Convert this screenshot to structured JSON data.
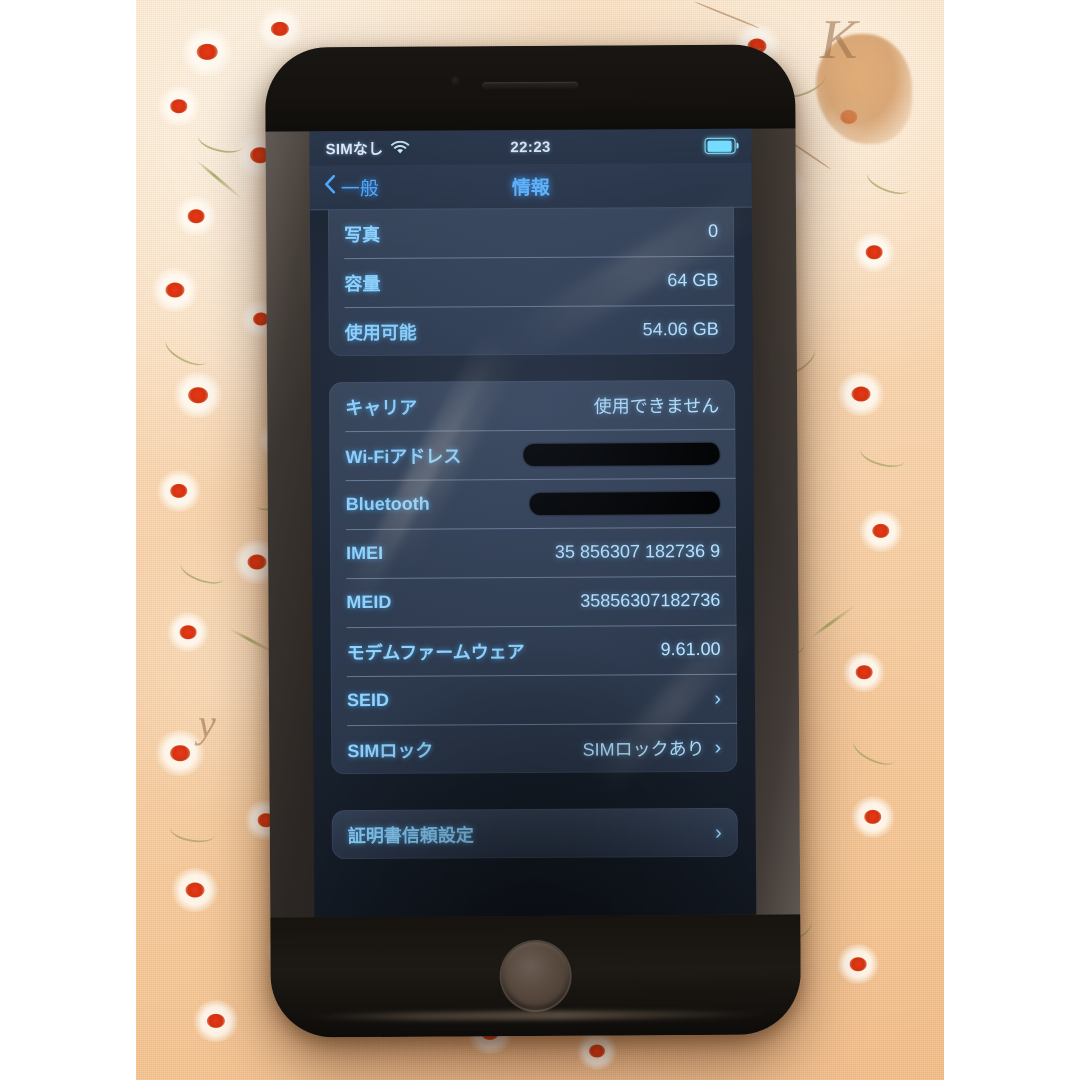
{
  "photo": {
    "subject": "iPhone displaying iOS Settings > General > About screen on floral fabric",
    "background_description": "peach floral fabric"
  },
  "device": {
    "home_button": "home-button",
    "earpiece": "earpiece-speaker",
    "front_camera": "front-camera"
  },
  "status_bar": {
    "carrier": "SIMなし",
    "wifi_icon": "wifi-icon",
    "time": "22:23",
    "battery_icon": "battery-icon",
    "battery_level_percent": 86
  },
  "nav_bar": {
    "back_icon": "chevron-left-icon",
    "back_label": "一般",
    "title": "情報"
  },
  "groups": [
    {
      "name": "storage-group",
      "rows": [
        {
          "label": "写真",
          "value": "0",
          "type": "value"
        },
        {
          "label": "容量",
          "value": "64 GB",
          "type": "value"
        },
        {
          "label": "使用可能",
          "value": "54.06 GB",
          "type": "value"
        }
      ]
    },
    {
      "name": "network-identity-group",
      "rows": [
        {
          "label": "キャリア",
          "value": "使用できません",
          "type": "value"
        },
        {
          "label": "Wi-Fiアドレス",
          "value": "",
          "type": "redacted"
        },
        {
          "label": "Bluetooth",
          "value": "",
          "type": "redacted"
        },
        {
          "label": "IMEI",
          "value": "35 856307 182736 9",
          "type": "value"
        },
        {
          "label": "MEID",
          "value": "35856307182736",
          "type": "value"
        },
        {
          "label": "モデムファームウェア",
          "value": "9.61.00",
          "type": "value"
        },
        {
          "label": "SEID",
          "value": "",
          "type": "chevron"
        },
        {
          "label": "SIMロック",
          "value": "SIMロックあり",
          "type": "value-chevron"
        }
      ]
    },
    {
      "name": "certificate-group",
      "rows": [
        {
          "label": "証明書信頼設定",
          "value": "",
          "type": "chevron"
        }
      ]
    }
  ],
  "colors": {
    "label_blue": "#8fd4ff",
    "value_blue": "#b9e3ff",
    "accent_blue": "#4ea8ff",
    "redaction_black": "#000000",
    "fabric_peach": "#f8cfa4",
    "flower_core_red": "#e8381a"
  }
}
